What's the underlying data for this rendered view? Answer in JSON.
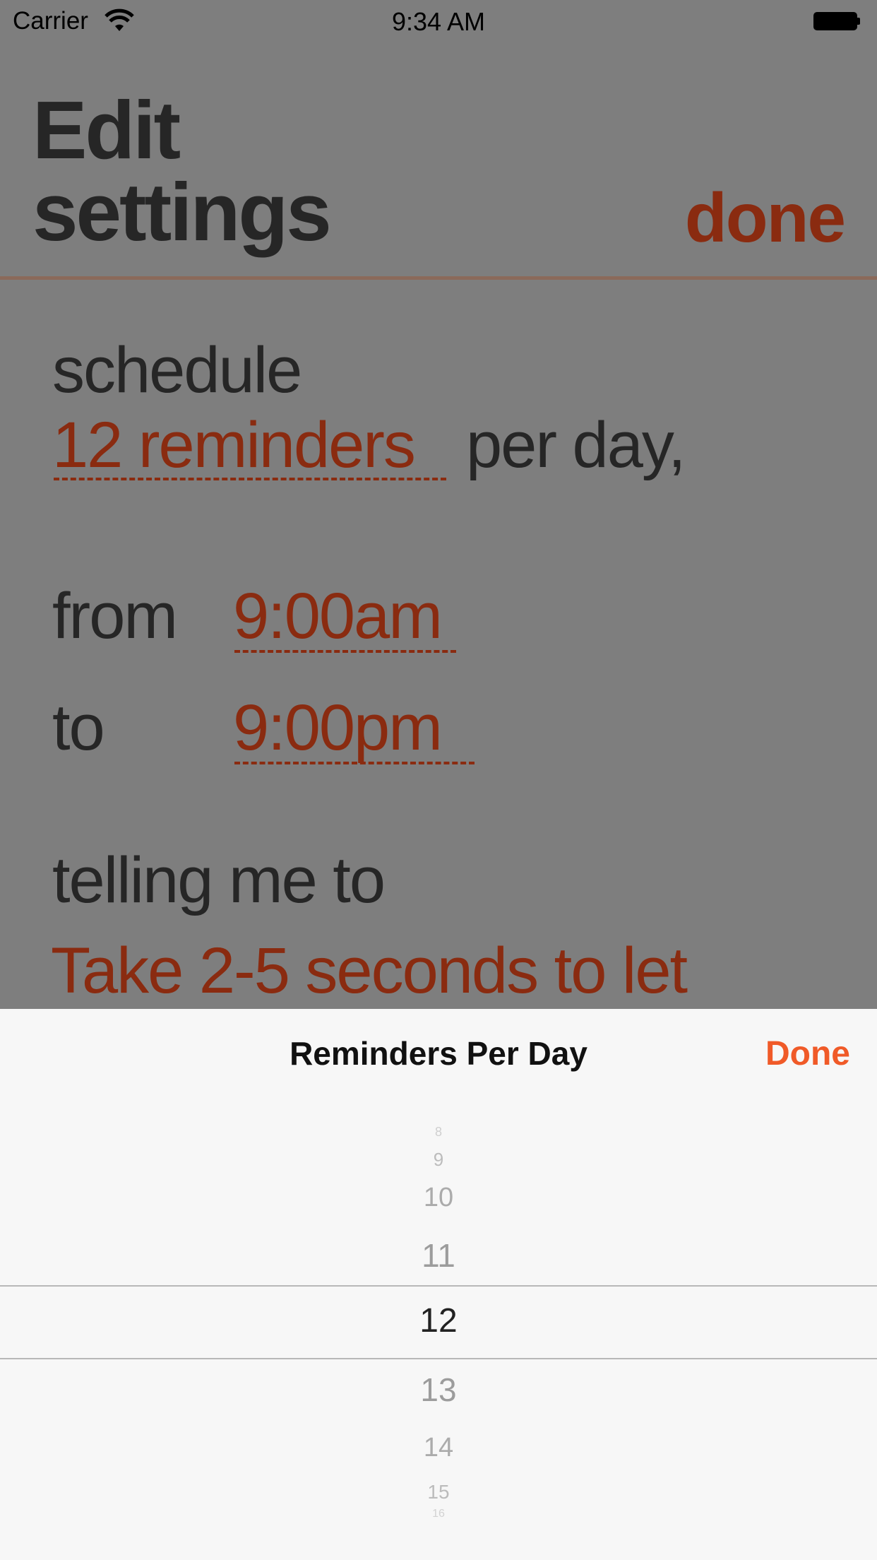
{
  "status_bar": {
    "carrier": "Carrier",
    "time": "9:34 AM",
    "wifi_icon": "wifi-icon",
    "battery_icon": "battery-icon"
  },
  "header": {
    "title_line1": "Edit",
    "title_line2": "settings",
    "done_label": "done"
  },
  "settings": {
    "schedule_label": "schedule",
    "reminders_value": "12 reminders",
    "per_day_text": "per day,",
    "from_label": "from",
    "from_value": "9:00am",
    "to_label": "to",
    "to_value": "9:00pm",
    "telling_label": "telling me to",
    "message_value": "Take 2-5 seconds to let"
  },
  "picker": {
    "title": "Reminders Per Day",
    "done_label": "Done",
    "selected": "12",
    "above": [
      "8",
      "9",
      "10",
      "11"
    ],
    "below": [
      "13",
      "14",
      "15",
      "16"
    ]
  },
  "colors": {
    "accent": "#8a2b10",
    "picker_done": "#f05a28",
    "overlay_background": "#7e7e7e"
  }
}
